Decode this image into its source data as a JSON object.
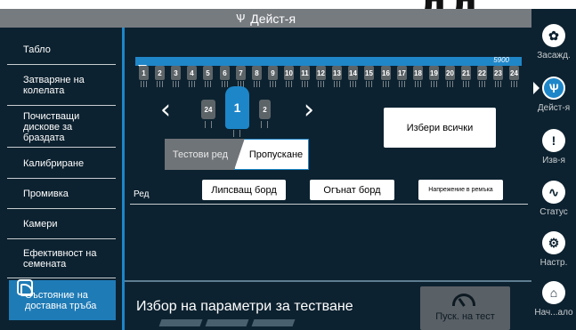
{
  "heading_fragment": "дд",
  "title_bar": {
    "title": "Дейст-я",
    "icon": "planter-icon"
  },
  "sidebar": {
    "items": [
      {
        "label": "Табло",
        "active": false
      },
      {
        "label": "Затваряне на колелата",
        "active": false
      },
      {
        "label": "Почистващи дискове за браздата",
        "active": false
      },
      {
        "label": "Калибриране",
        "active": false
      },
      {
        "label": "Промивка",
        "active": false
      },
      {
        "label": "Камери",
        "active": false
      },
      {
        "label": "Ефективност на семената",
        "active": false
      },
      {
        "label": "Състояние на доставна тръба",
        "active": true
      }
    ]
  },
  "row_strip": {
    "value": "5900"
  },
  "row_units": [
    "1",
    "2",
    "3",
    "4",
    "5",
    "6",
    "7",
    "8",
    "9",
    "10",
    "11",
    "12",
    "13",
    "14",
    "15",
    "16",
    "17",
    "18",
    "19",
    "20",
    "21",
    "22",
    "23",
    "24"
  ],
  "row_selector": {
    "prev": "24",
    "current": "1",
    "next": "2",
    "prev_arrow": "‹",
    "next_arrow": "›"
  },
  "select_all_button": "Избери всички",
  "mode_toggle": {
    "test_row": "Тестови ред",
    "skip": "Пропускане",
    "selected": "skip"
  },
  "row_label": "Ред",
  "status_buttons": {
    "missing_board": "Липсващ борд",
    "bent_board": "Огънат борд",
    "belt_tension": "Напрежение в ремъка"
  },
  "bottom": {
    "title": "Избор на параметри за тестване",
    "start_test": "Пуск. на тест"
  },
  "rightbar": {
    "items": [
      {
        "label": "Засажд.",
        "icon": "seedling-icon",
        "active": false
      },
      {
        "label": "Дейст-я",
        "icon": "planter-icon",
        "active": true
      },
      {
        "label": "Изв-я",
        "icon": "alert-shield-icon",
        "active": false
      },
      {
        "label": "Статус",
        "icon": "pulse-icon",
        "active": false
      },
      {
        "label": "Настр.",
        "icon": "gear-icon",
        "active": false
      },
      {
        "label": "Нач...ало",
        "icon": "home-icon",
        "active": false
      }
    ]
  },
  "colors": {
    "accent": "#1d86c9",
    "panel_bg": "#0c2230",
    "title_bar": "#767b80"
  }
}
